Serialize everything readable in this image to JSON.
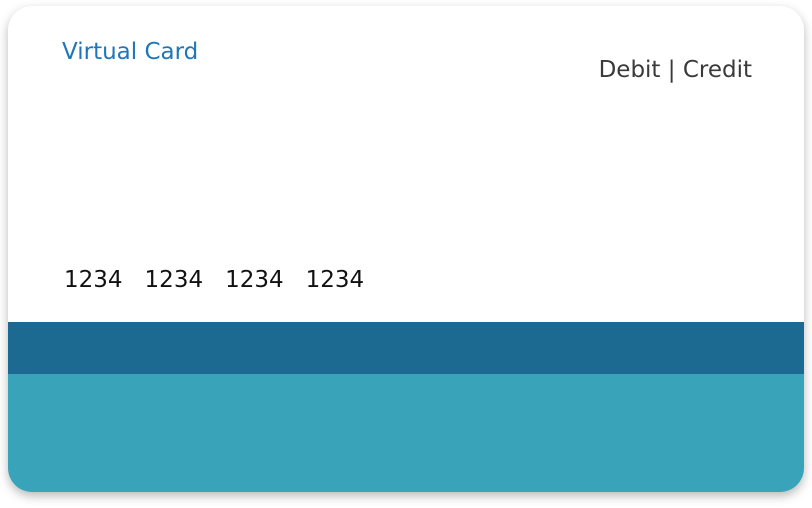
{
  "card": {
    "title": "Virtual Card",
    "type_label": "Debit | Credit",
    "number_groups": [
      "1234",
      "1234",
      "1234",
      "1234"
    ]
  },
  "colors": {
    "title": "#1f76b8",
    "band_top": "#1c6a92",
    "band_bottom": "#38a3b9"
  }
}
